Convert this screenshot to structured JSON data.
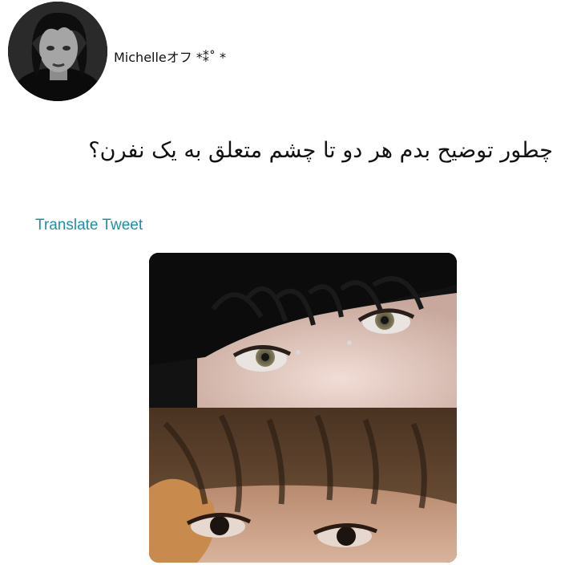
{
  "profile": {
    "username": "Michelleオフ *⁑˚ *"
  },
  "tweet": {
    "text": "چطور توضیح بدم هر دو تا چشم متعلق به یک نفرن؟",
    "translate_label": "Translate Tweet"
  },
  "colors": {
    "link": "#1f8fa8",
    "text": "#111111",
    "background": "#ffffff"
  }
}
